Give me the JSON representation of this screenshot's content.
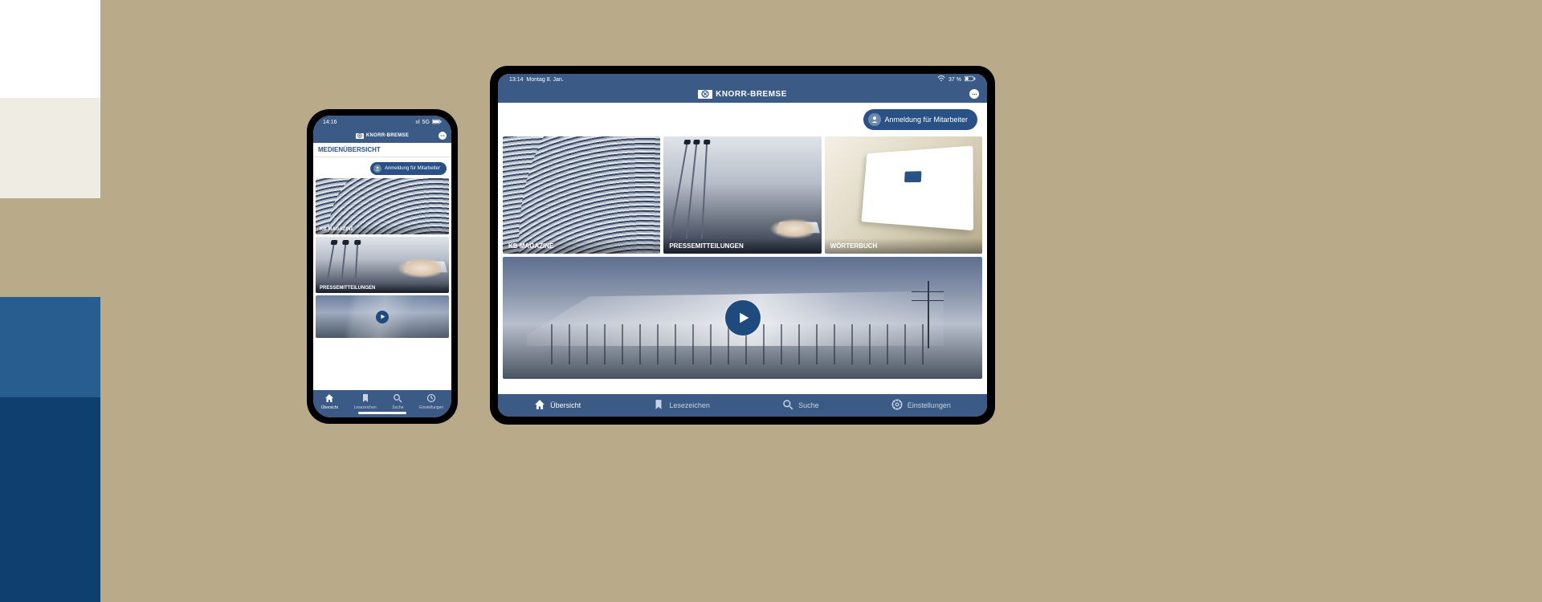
{
  "brand": {
    "name": "KNORR-BREMSE"
  },
  "phone": {
    "status": {
      "time": "14:16",
      "network": "5G",
      "signal": "ııl"
    },
    "section_title": "MEDIENÜBERSICHT",
    "login_label": "Anmeldung für Mitarbeiter",
    "tiles": [
      {
        "label": "KB MAGAZINE"
      },
      {
        "label": "PRESSEMITTEILUNGEN"
      }
    ],
    "tabs": [
      {
        "label": "Übersicht"
      },
      {
        "label": "Lesezeichen"
      },
      {
        "label": "Suche"
      },
      {
        "label": "Einstellungen"
      }
    ]
  },
  "tablet": {
    "status": {
      "time": "13:14",
      "date": "Montag 8. Jan.",
      "battery": "37 %"
    },
    "login_label": "Anmeldung für Mitarbeiter",
    "tiles": [
      {
        "label": "KB MAGAZINE"
      },
      {
        "label": "PRESSEMITTEILUNGEN"
      },
      {
        "label": "WÖRTERBUCH"
      }
    ],
    "tabs": [
      {
        "label": "Übersicht"
      },
      {
        "label": "Lesezeichen"
      },
      {
        "label": "Suche"
      },
      {
        "label": "Einstellungen"
      }
    ]
  }
}
